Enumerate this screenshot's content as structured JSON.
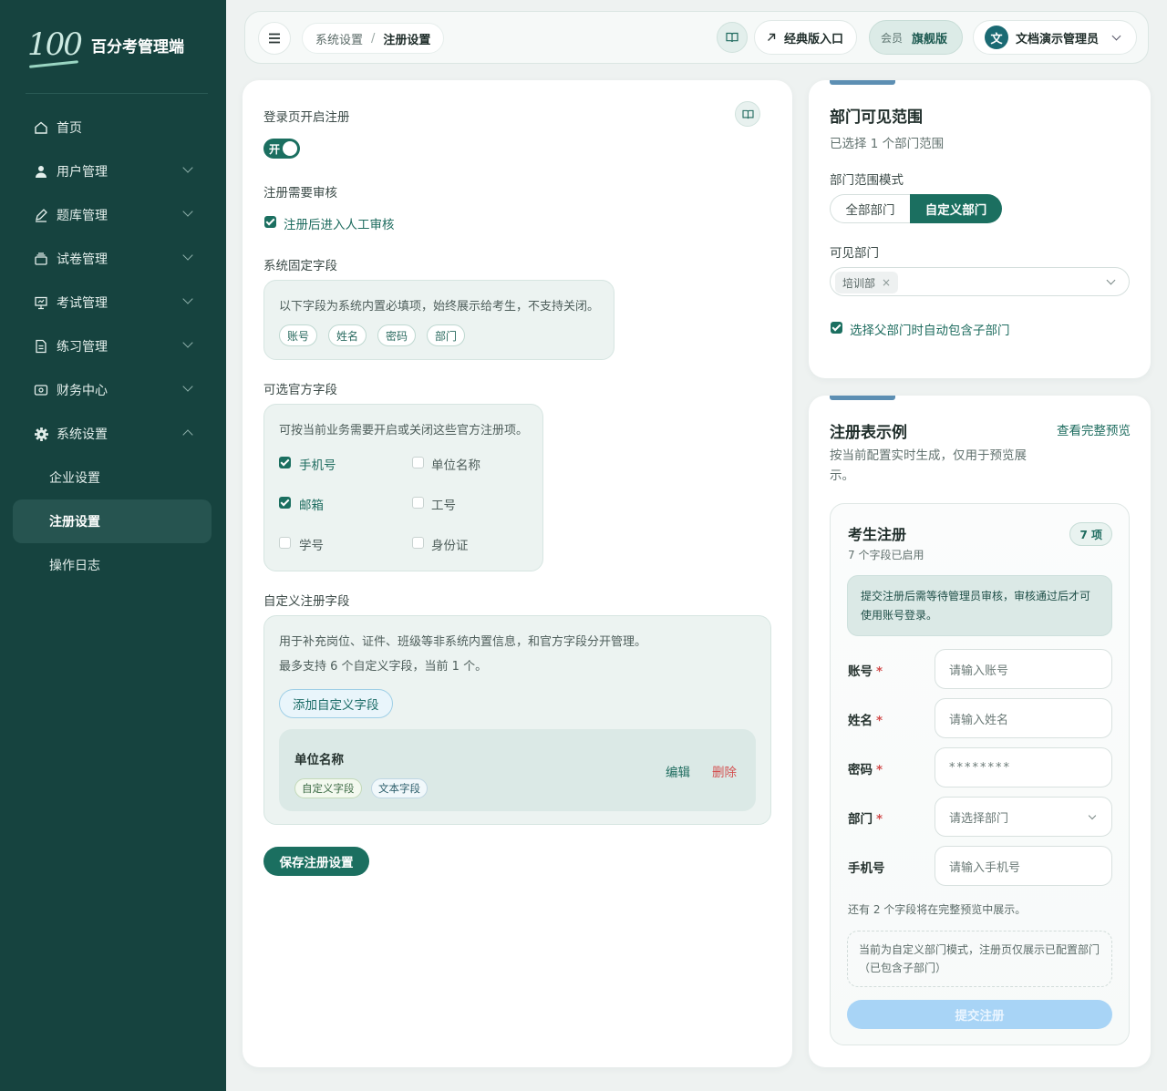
{
  "app": {
    "logo_mark": "100",
    "name": "百分考管理端"
  },
  "sidebar": {
    "items": [
      {
        "label": "首页",
        "icon": "home-icon"
      },
      {
        "label": "用户管理",
        "icon": "user-icon"
      },
      {
        "label": "题库管理",
        "icon": "edit-icon"
      },
      {
        "label": "试卷管理",
        "icon": "layers-icon"
      },
      {
        "label": "考试管理",
        "icon": "presentation-icon"
      },
      {
        "label": "练习管理",
        "icon": "document-icon"
      },
      {
        "label": "财务中心",
        "icon": "wallet-icon"
      },
      {
        "label": "系统设置",
        "icon": "gear-icon"
      }
    ],
    "sub_items": [
      {
        "label": "企业设置"
      },
      {
        "label": "注册设置",
        "active": true
      },
      {
        "label": "操作日志"
      }
    ]
  },
  "topbar": {
    "breadcrumb": [
      "系统设置",
      "注册设置"
    ],
    "breadcrumb_sep": "/",
    "classic_label": "经典版入口",
    "member_label": "会员",
    "member_value": "旗舰版",
    "avatar_char": "文",
    "user_name": "文档演示管理员"
  },
  "main": {
    "login_register_label": "登录页开启注册",
    "toggle_text": "开",
    "audit_label": "注册需要审核",
    "audit_checkbox": "注册后进入人工审核",
    "fixed_label": "系统固定字段",
    "fixed_desc": "以下字段为系统内置必填项，始终展示给考生，不支持关闭。",
    "fixed_tags": [
      "账号",
      "姓名",
      "密码",
      "部门"
    ],
    "optional_label": "可选官方字段",
    "optional_desc": "可按当前业务需要开启或关闭这些官方注册项。",
    "optional_fields": [
      {
        "label": "手机号",
        "checked": true
      },
      {
        "label": "单位名称",
        "checked": false
      },
      {
        "label": "邮箱",
        "checked": true
      },
      {
        "label": "工号",
        "checked": false
      },
      {
        "label": "学号",
        "checked": false
      },
      {
        "label": "身份证",
        "checked": false
      }
    ],
    "custom_label": "自定义注册字段",
    "custom_desc1": "用于补充岗位、证件、班级等非系统内置信息，和官方字段分开管理。",
    "custom_desc2": "最多支持 6 个自定义字段，当前 1 个。",
    "add_custom_button": "添加自定义字段",
    "custom_item": {
      "title": "单位名称",
      "tag1": "自定义字段",
      "tag2": "文本字段",
      "edit": "编辑",
      "delete": "删除"
    },
    "save_button": "保存注册设置"
  },
  "dept": {
    "title": "部门可见范围",
    "subtitle": "已选择 1 个部门范围",
    "mode_label": "部门范围模式",
    "mode_options": [
      "全部部门",
      "自定义部门"
    ],
    "mode_selected": "自定义部门",
    "visible_label": "可见部门",
    "visible_tag": "培训部",
    "tag_close": "×",
    "include_children": "选择父部门时自动包含子部门"
  },
  "form_preview": {
    "title": "注册表示例",
    "view_full_link": "查看完整预览",
    "subtitle": "按当前配置实时生成，仅用于预览展示。",
    "card_title": "考生注册",
    "card_sub": "7 个字段已启用",
    "count_badge": "7 项",
    "notice": "提交注册后需等待管理员审核，审核通过后才可使用账号登录。",
    "required_mark": "*",
    "fields": [
      {
        "label": "账号",
        "required": true,
        "placeholder": "请输入账号"
      },
      {
        "label": "姓名",
        "required": true,
        "placeholder": "请输入姓名"
      },
      {
        "label": "密码",
        "required": true,
        "placeholder": "********"
      },
      {
        "label": "部门",
        "required": true,
        "placeholder": "请选择部门"
      },
      {
        "label": "手机号",
        "required": false,
        "placeholder": "请输入手机号"
      }
    ],
    "more_text": "还有 2 个字段将在完整预览中展示。",
    "dept_notice": "当前为自定义部门模式，注册页仅展示已配置部门（已包含子部门）",
    "submit_button": "提交注册"
  },
  "colors": {
    "sidebar_bg": "#16433f",
    "primary": "#1b6f60",
    "danger": "#d35050",
    "submit_disabled": "#a8d4f6"
  }
}
